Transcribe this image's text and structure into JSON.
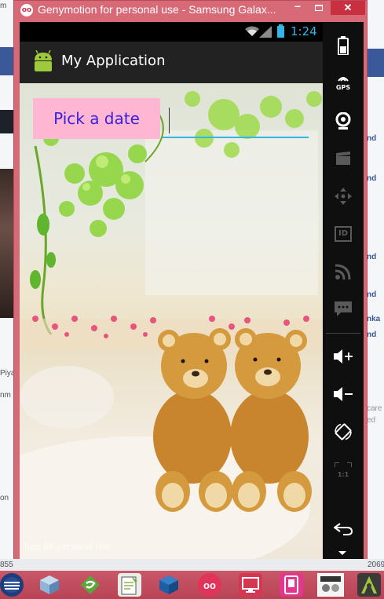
{
  "window": {
    "title": "Genymotion for personal use - Samsung Galax...",
    "minimize": "–",
    "close": "✕"
  },
  "statusbar": {
    "time": "1:24"
  },
  "app": {
    "title": "My Application",
    "pick_date_label": "Pick a date",
    "date_field_value": "",
    "watermark": "free for personal use"
  },
  "control_panel": {
    "gps_label": "GPS",
    "id_label": "ID",
    "zoom_label": "1:1"
  },
  "background_right": {
    "lines": [
      "nd",
      "nd",
      "nd",
      "nd",
      "nka",
      "nd"
    ],
    "gray_lines": [
      "care",
      "ed"
    ]
  },
  "background_left": {
    "lines": [
      "Piya",
      "nm",
      "on"
    ],
    "top_fragment": "m"
  },
  "bottom_strip": {
    "left_number": "855",
    "right_number": "2069"
  },
  "colors": {
    "window_frame": "#d86a78",
    "pick_button_bg": "#ffb6d2",
    "pick_button_text": "#3a21d9",
    "accent": "#33b5e5"
  }
}
